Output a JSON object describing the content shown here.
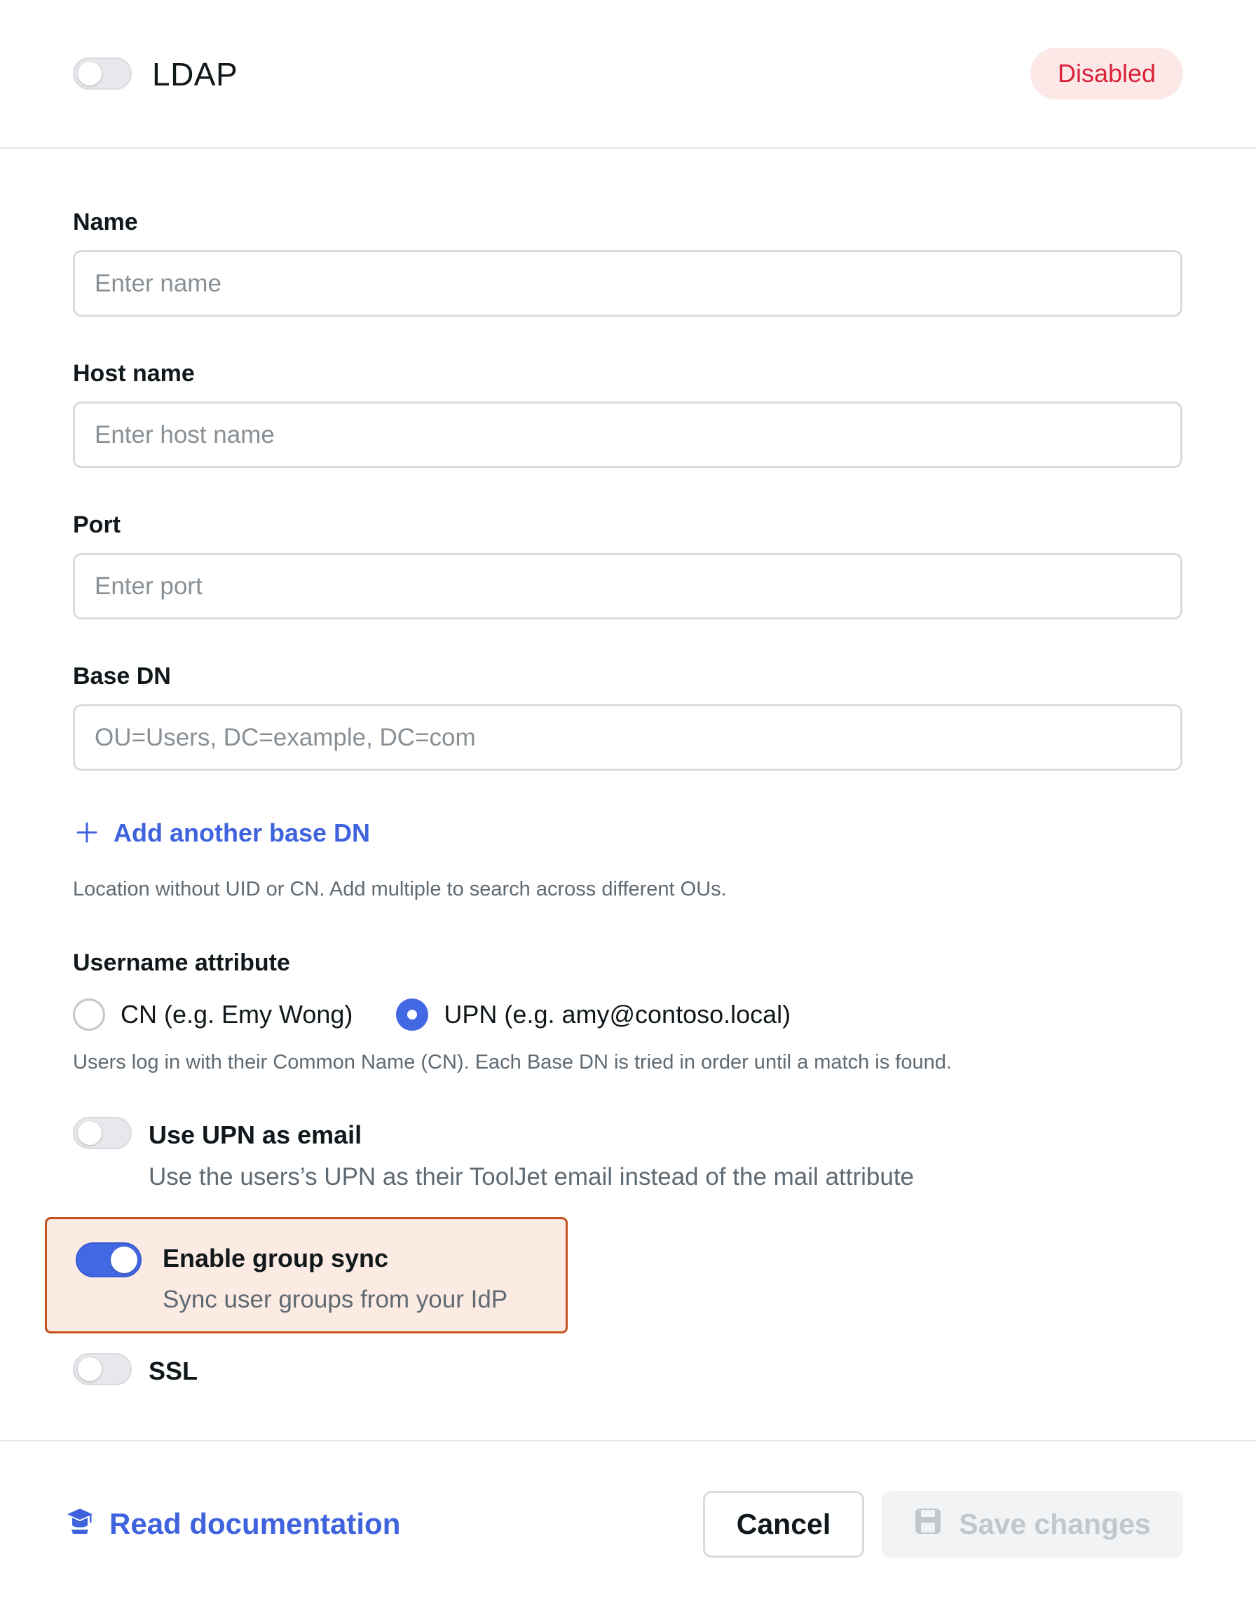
{
  "header": {
    "title": "LDAP",
    "status_badge": "Disabled",
    "enabled": false
  },
  "form": {
    "name": {
      "label": "Name",
      "placeholder": "Enter name",
      "value": ""
    },
    "host_name": {
      "label": "Host name",
      "placeholder": "Enter host name",
      "value": ""
    },
    "port": {
      "label": "Port",
      "placeholder": "Enter port",
      "value": ""
    },
    "base_dn": {
      "label": "Base DN",
      "placeholder": "OU=Users, DC=example, DC=com",
      "value": ""
    },
    "add_base_dn_label": "Add another base DN",
    "base_dn_help": "Location without UID or CN. Add multiple to search across different OUs.",
    "username_attribute": {
      "label": "Username attribute",
      "options": [
        {
          "label": "CN (e.g. Emy Wong)",
          "checked": false
        },
        {
          "label": "UPN (e.g. amy@contoso.local)",
          "checked": true
        }
      ],
      "help": "Users log in with their Common Name (CN). Each Base DN is tried in order until a match is found."
    },
    "use_upn_email": {
      "title": "Use UPN as email",
      "description": "Use the users’s UPN as their ToolJet email instead of the mail attribute",
      "enabled": false
    },
    "group_sync": {
      "title": "Enable group sync",
      "description": "Sync user groups from your IdP",
      "enabled": true
    },
    "ssl": {
      "title": "SSL",
      "enabled": false
    }
  },
  "footer": {
    "doc_link": "Read documentation",
    "cancel_label": "Cancel",
    "save_label": "Save changes"
  },
  "colors": {
    "accent": "#3e63dd",
    "danger": "#d8233a",
    "highlight_border": "#c2521e",
    "highlight_bg": "#fbebe3"
  },
  "icons": {
    "add": "plus-icon",
    "docs": "graduation-cap-icon",
    "save": "floppy-disk-icon"
  }
}
